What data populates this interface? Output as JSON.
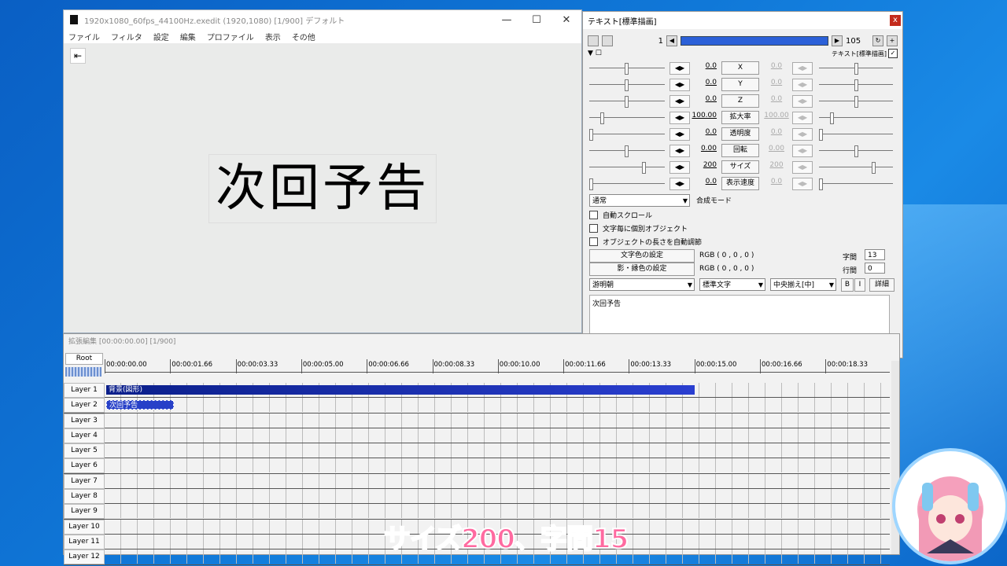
{
  "main_window": {
    "title": "1920x1080_60fps_44100Hz.exedit (1920,1080)  [1/900]  デフォルト",
    "minimize": "—",
    "maximize": "☐",
    "close": "✕",
    "menu": [
      "ファイル",
      "フィルタ",
      "設定",
      "編集",
      "プロファイル",
      "表示",
      "その他"
    ],
    "back_icon": "⇤",
    "preview_text": "次回予告"
  },
  "text_dialog": {
    "title": "テキスト[標準描画]",
    "close": "x",
    "frame_start": "1",
    "frame_end": "105",
    "effect_label": "テキスト[標準描画]",
    "params": [
      {
        "label": "X",
        "left": "0.0",
        "right": "0.0"
      },
      {
        "label": "Y",
        "left": "0.0",
        "right": "0.0"
      },
      {
        "label": "Z",
        "left": "0.0",
        "right": "0.0"
      },
      {
        "label": "拡大率",
        "left": "100.00",
        "right": "100.00"
      },
      {
        "label": "透明度",
        "left": "0.0",
        "right": "0.0"
      },
      {
        "label": "回転",
        "left": "0.00",
        "right": "0.00"
      },
      {
        "label": "サイズ",
        "left": "200",
        "right": "200"
      },
      {
        "label": "表示速度",
        "left": "0.0",
        "right": "0.0"
      }
    ],
    "blend_mode": "通常",
    "blend_label": "合成モード",
    "checks": [
      "自動スクロール",
      "文字毎に個別オブジェクト",
      "オブジェクトの長さを自動調節"
    ],
    "color_btn": "文字色の設定",
    "color_val": "RGB ( 0 , 0 , 0 )",
    "shadow_btn": "影・縁色の設定",
    "shadow_val": "RGB ( 0 , 0 , 0 )",
    "spacing_label": "字間",
    "spacing_val": "13",
    "line_label": "行間",
    "line_val": "0",
    "font": "游明朝",
    "style": "標準文字",
    "align": "中央揃え[中]",
    "bold": "B",
    "italic": "I",
    "detail": "詳細",
    "text_content": "次回予告"
  },
  "timeline": {
    "title": "拡張編集 [00:00:00.00] [1/900]",
    "root": "Root",
    "ticks": [
      "00:00:00.00",
      "00:00:01.66",
      "00:00:03.33",
      "00:00:05.00",
      "00:00:06.66",
      "00:00:08.33",
      "00:00:10.00",
      "00:00:11.66",
      "00:00:13.33",
      "00:00:15.00",
      "00:00:16.66",
      "00:00:18.33"
    ],
    "layers": [
      "Layer 1",
      "Layer 2",
      "Layer 3",
      "Layer 4",
      "Layer 5",
      "Layer 6",
      "Layer 7",
      "Layer 8",
      "Layer 9",
      "Layer 10",
      "Layer 11",
      "Layer 12"
    ],
    "clip1": "背景(図形)",
    "clip2": "次回予告"
  },
  "caption": "サイズ200、字間15"
}
